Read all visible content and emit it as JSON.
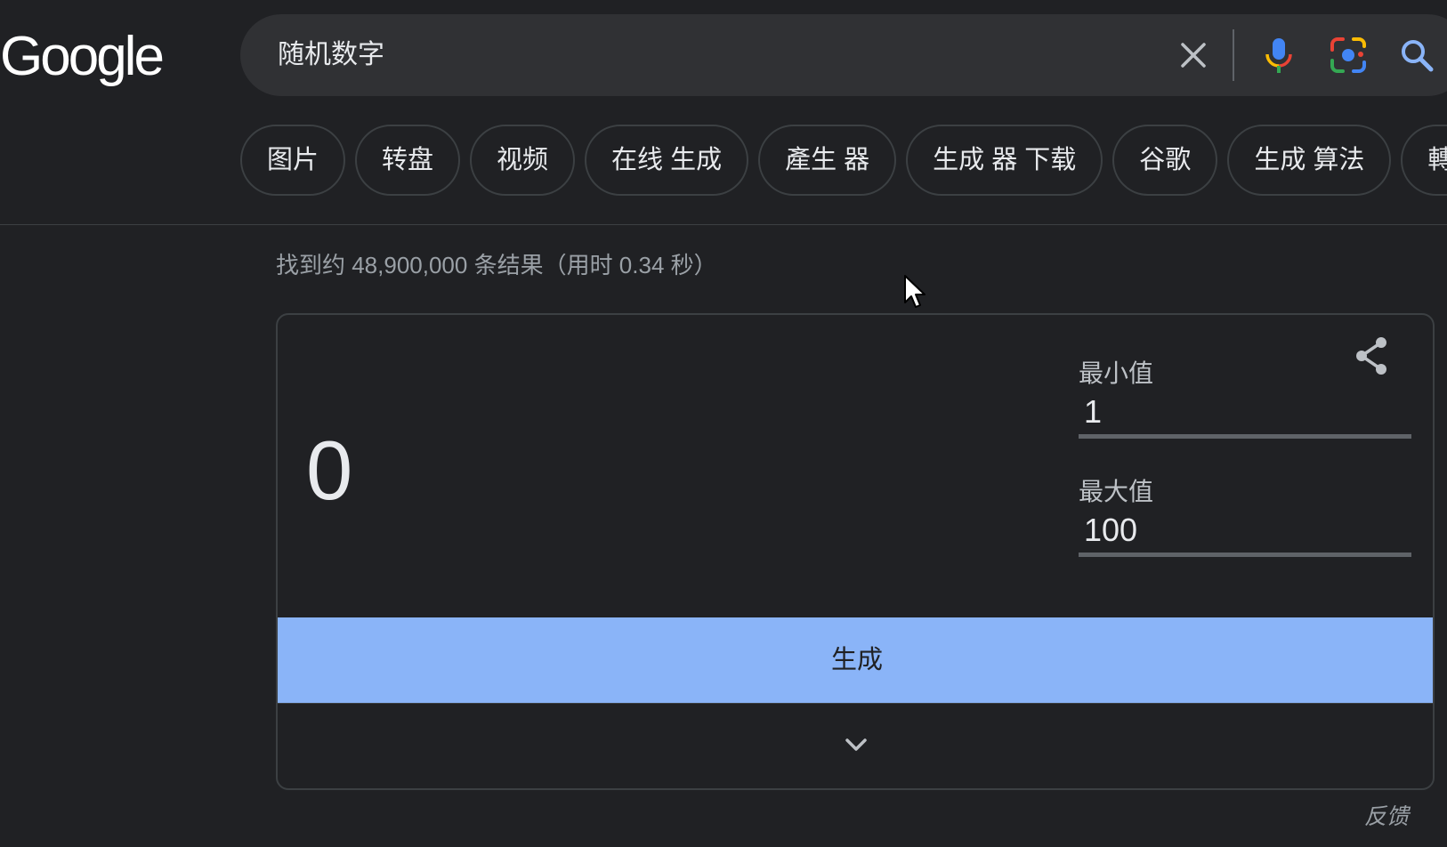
{
  "logo": {
    "text": "Google"
  },
  "search": {
    "query": "随机数字"
  },
  "chips": [
    {
      "label": "图片"
    },
    {
      "label": "转盘"
    },
    {
      "label": "视频"
    },
    {
      "label": "在线 生成"
    },
    {
      "label": "產生 器"
    },
    {
      "label": "生成 器 下载"
    },
    {
      "label": "谷歌"
    },
    {
      "label": "生成 算法"
    },
    {
      "label": "轉盤"
    }
  ],
  "results": {
    "stats": "找到约 48,900,000 条结果（用时 0.34 秒）"
  },
  "rng_card": {
    "result": "0",
    "min_label": "最小值",
    "min_value": "1",
    "max_label": "最大值",
    "max_value": "100",
    "generate_label": "生成"
  },
  "feedback": {
    "label": "反馈"
  },
  "colors": {
    "background": "#202124",
    "search_bg": "#303134",
    "accent_button": "#8ab4f8",
    "border": "#3c4043",
    "mic_blue": "#4285f4",
    "mic_red": "#ea4335",
    "mic_yellow": "#fbbc04",
    "mic_green": "#34a853"
  },
  "icons": {
    "clear": "close-icon",
    "mic": "microphone-icon",
    "lens": "google-lens-icon",
    "search": "search-icon",
    "share": "share-icon",
    "expand": "chevron-down-icon"
  }
}
